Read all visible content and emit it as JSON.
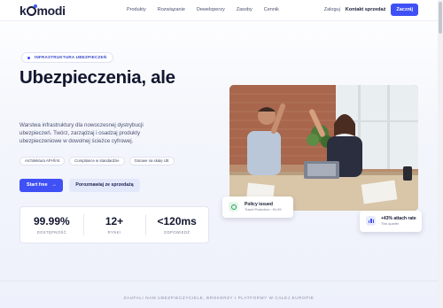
{
  "brand": {
    "logo": "komodi"
  },
  "nav": {
    "links": [
      "Produkty",
      "Rozwiązanie",
      "Deweloperzy",
      "Zasoby",
      "Cennik"
    ],
    "login": "Zaloguj",
    "contact": "Kontakt sprzedaż",
    "cta": "Zacznij"
  },
  "hero": {
    "pill": "INFRASTRUKTURA UBEZPIECZEŃ",
    "title": "Ubezpieczenia, ale",
    "description": "Warstwa infrastruktury dla nowoczesnej dystrybucji ubezpieczeń. Twórz, zarządzaj i osadzaj produkty ubezpieczeniowe w dowolnej ścieżce cyfrowej.",
    "tags": [
      "Architektura API-first",
      "Compliance w standardzie",
      "Gotowe na skalę UE"
    ],
    "primary_cta": "Start free",
    "primary_cta_arrow": "→",
    "secondary_cta": "Porozmawiaj ze sprzedażą"
  },
  "stats": [
    {
      "value": "99.99%",
      "label": "DOSTĘPNOŚĆ"
    },
    {
      "value": "12+",
      "label": "RYNKI"
    },
    {
      "value": "<120ms",
      "label": "ODPOWIEDŹ"
    }
  ],
  "cards": {
    "policy": {
      "title": "Policy issued",
      "subtitle": "Travel Protection · €4.99"
    },
    "attach": {
      "title": "+43% attach rate",
      "subtitle": "This quarter"
    }
  },
  "trust": {
    "text": "ZAUFALI NAM UBEZPIECZYCIELE, BROKERZY I PLATFORMY W CAŁEJ EUROPIE"
  },
  "colors": {
    "accent": "#3f51f5",
    "text": "#12162e",
    "muted": "#7a8098",
    "success": "#2e9e5b"
  }
}
